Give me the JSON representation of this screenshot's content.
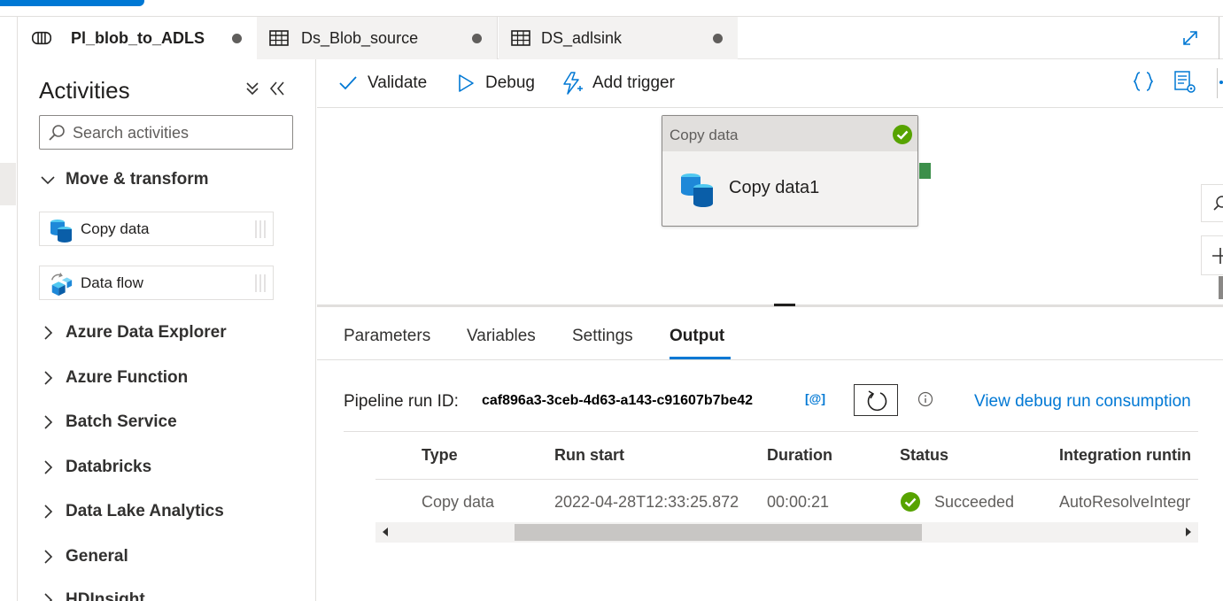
{
  "tabs": [
    {
      "label": "Pl_blob_to_ADLS",
      "icon": "pipeline-icon",
      "active": true,
      "unsaved": true
    },
    {
      "label": "Ds_Blob_source",
      "icon": "table-icon",
      "active": false,
      "unsaved": true
    },
    {
      "label": "DS_adlsink",
      "icon": "table-icon",
      "active": false,
      "unsaved": true
    }
  ],
  "activities": {
    "title": "Activities",
    "search_placeholder": "Search activities",
    "groups": [
      {
        "label": "Move & transform",
        "expanded": true
      },
      {
        "label": "Azure Data Explorer",
        "expanded": false
      },
      {
        "label": "Azure Function",
        "expanded": false
      },
      {
        "label": "Batch Service",
        "expanded": false
      },
      {
        "label": "Databricks",
        "expanded": false
      },
      {
        "label": "Data Lake Analytics",
        "expanded": false
      },
      {
        "label": "General",
        "expanded": false
      },
      {
        "label": "HDInsight",
        "expanded": false
      }
    ],
    "items": [
      {
        "label": "Copy data",
        "icon": "copy-data-icon"
      },
      {
        "label": "Data flow",
        "icon": "data-flow-icon"
      }
    ]
  },
  "toolbar": {
    "validate": "Validate",
    "debug": "Debug",
    "add_trigger": "Add trigger"
  },
  "canvas": {
    "node": {
      "type": "Copy data",
      "name": "Copy data1",
      "status": "succeeded"
    }
  },
  "panel": {
    "tabs": [
      "Parameters",
      "Variables",
      "Settings",
      "Output"
    ],
    "active_tab": "Output",
    "run_id_label": "Pipeline run ID:",
    "run_id": "caf896a3-3ceb-4d63-a143-c91607b7be42",
    "copy_label": "[@]",
    "debug_link": "View debug run consumption",
    "table": {
      "headers": [
        "Type",
        "Run start",
        "Duration",
        "Status",
        "Integration runtin"
      ],
      "rows": [
        {
          "type": "Copy data",
          "run_start": "2022-04-28T12:33:25.872",
          "duration": "00:00:21",
          "status": "Succeeded",
          "integration_runtime": "AutoResolveIntegr"
        }
      ]
    }
  },
  "colors": {
    "accent": "#0078d4",
    "success": "#57a300",
    "handle": "#3c8f4a"
  }
}
